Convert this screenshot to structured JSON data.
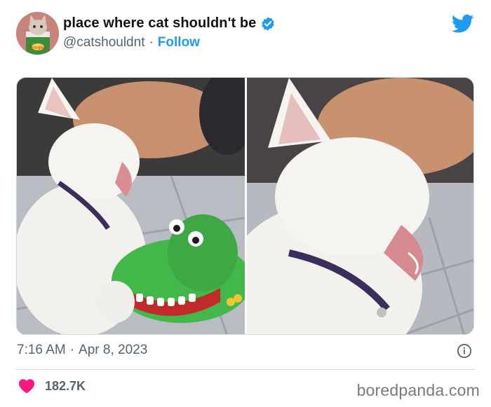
{
  "author": {
    "display_name": "place where cat shouldn't be",
    "handle": "@catshouldnt",
    "separator": "·",
    "follow_label": "Follow",
    "avatar_label": "Pringles"
  },
  "tweet": {
    "time": "7:16 AM",
    "separator": "·",
    "date": "Apr 8, 2023",
    "likes": "182.7K"
  },
  "media": {
    "panels": [
      "cat-with-crocodile-toy",
      "cat-yawning-closeup"
    ]
  },
  "icons": {
    "verified": "verified-badge-icon",
    "platform": "twitter-bird-icon",
    "info": "info-icon",
    "like": "heart-icon"
  },
  "colors": {
    "accent": "#1d9bf0",
    "like": "#f91880",
    "muted_text": "#536471"
  },
  "watermark": "boredpanda.com"
}
